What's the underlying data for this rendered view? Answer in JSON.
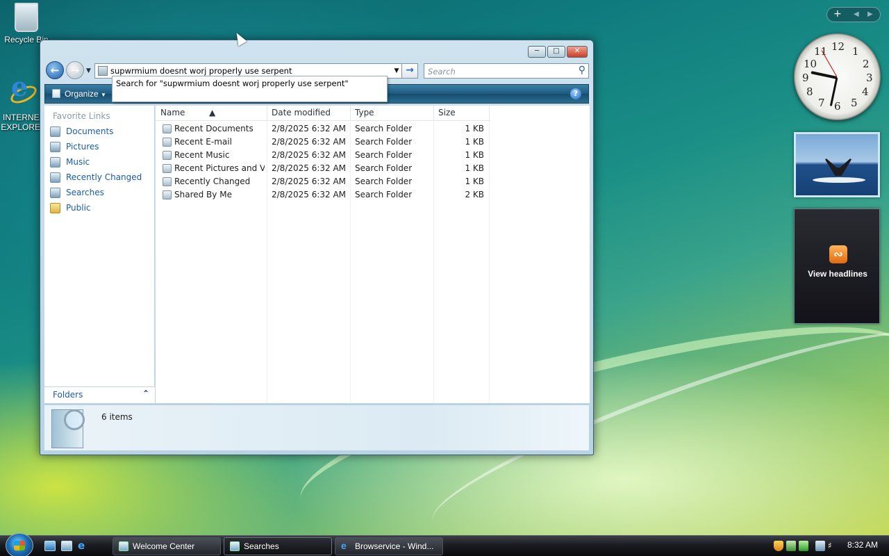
{
  "desktop": {
    "icons": [
      {
        "label": "Recycle Bin"
      },
      {
        "label": "INTERNET EXPLORER"
      }
    ]
  },
  "explorer": {
    "address_value": "supwrmium doesnt worj properly use serpent",
    "search_placeholder": "Search",
    "autocomplete": "Search for \"supwrmium doesnt worj properly use serpent\"",
    "toolbar": {
      "organize_label": "Organize",
      "help_label": "?"
    },
    "favorite_links_title": "Favorite Links",
    "favorite_links": [
      {
        "label": "Documents",
        "icon": "documents-icon"
      },
      {
        "label": "Pictures",
        "icon": "pictures-icon"
      },
      {
        "label": "Music",
        "icon": "music-icon"
      },
      {
        "label": "Recently Changed",
        "icon": "recently-changed-icon"
      },
      {
        "label": "Searches",
        "icon": "searches-icon"
      },
      {
        "label": "Public",
        "icon": "folder-icon"
      }
    ],
    "folders_label": "Folders",
    "columns": [
      "Name",
      "Date modified",
      "Type",
      "Size"
    ],
    "rows": [
      {
        "name": "Recent Documents",
        "date": "2/8/2025 6:32 AM",
        "type": "Search Folder",
        "size": "1 KB"
      },
      {
        "name": "Recent E-mail",
        "date": "2/8/2025 6:32 AM",
        "type": "Search Folder",
        "size": "1 KB"
      },
      {
        "name": "Recent Music",
        "date": "2/8/2025 6:32 AM",
        "type": "Search Folder",
        "size": "1 KB"
      },
      {
        "name": "Recent Pictures and Vi...",
        "date": "2/8/2025 6:32 AM",
        "type": "Search Folder",
        "size": "1 KB"
      },
      {
        "name": "Recently Changed",
        "date": "2/8/2025 6:32 AM",
        "type": "Search Folder",
        "size": "1 KB"
      },
      {
        "name": "Shared By Me",
        "date": "2/8/2025 6:32 AM",
        "type": "Search Folder",
        "size": "2 KB"
      }
    ],
    "item_count": "6 items"
  },
  "sidebar": {
    "clock_numbers": [
      "12",
      "1",
      "2",
      "3",
      "4",
      "5",
      "6",
      "7",
      "8",
      "9",
      "10",
      "11"
    ],
    "feed_label": "View headlines"
  },
  "taskbar": {
    "buttons": [
      {
        "label": "Welcome Center"
      },
      {
        "label": "Searches"
      },
      {
        "label": "Browservice - Wind..."
      }
    ],
    "time": "8:32 AM"
  }
}
